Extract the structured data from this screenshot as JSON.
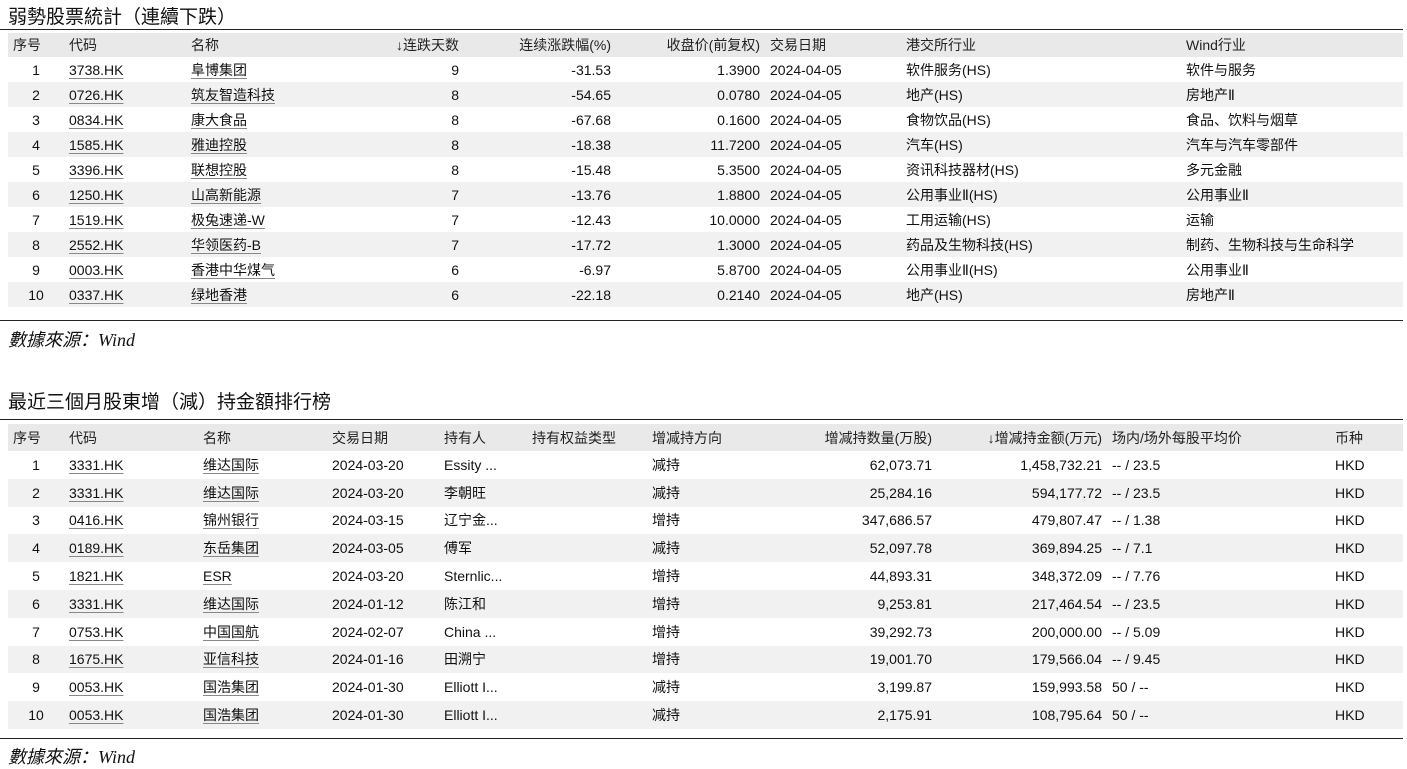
{
  "section1": {
    "title": "弱勢股票統計（連續下跌）",
    "headers": [
      "序号",
      "代码",
      "名称",
      "↓连跌天数",
      "连续涨跌幅(%)",
      "收盘价(前复权)",
      "交易日期",
      "港交所行业",
      "Wind行业"
    ],
    "rows": [
      [
        "1",
        "3738.HK",
        "阜博集团",
        "9",
        "-31.53",
        "1.3900",
        "2024-04-05",
        "软件服务(HS)",
        "软件与服务"
      ],
      [
        "2",
        "0726.HK",
        "筑友智造科技",
        "8",
        "-54.65",
        "0.0780",
        "2024-04-05",
        "地产(HS)",
        "房地产Ⅱ"
      ],
      [
        "3",
        "0834.HK",
        "康大食品",
        "8",
        "-67.68",
        "0.1600",
        "2024-04-05",
        "食物饮品(HS)",
        "食品、饮料与烟草"
      ],
      [
        "4",
        "1585.HK",
        "雅迪控股",
        "8",
        "-18.38",
        "11.7200",
        "2024-04-05",
        "汽车(HS)",
        "汽车与汽车零部件"
      ],
      [
        "5",
        "3396.HK",
        "联想控股",
        "8",
        "-15.48",
        "5.3500",
        "2024-04-05",
        "资讯科技器材(HS)",
        "多元金融"
      ],
      [
        "6",
        "1250.HK",
        "山高新能源",
        "7",
        "-13.76",
        "1.8800",
        "2024-04-05",
        "公用事业Ⅱ(HS)",
        "公用事业Ⅱ"
      ],
      [
        "7",
        "1519.HK",
        "极兔速递-W",
        "7",
        "-12.43",
        "10.0000",
        "2024-04-05",
        "工用运输(HS)",
        "运输"
      ],
      [
        "8",
        "2552.HK",
        "华领医药-B",
        "7",
        "-17.72",
        "1.3000",
        "2024-04-05",
        "药品及生物科技(HS)",
        "制药、生物科技与生命科学"
      ],
      [
        "9",
        "0003.HK",
        "香港中华煤气",
        "6",
        "-6.97",
        "5.8700",
        "2024-04-05",
        "公用事业Ⅱ(HS)",
        "公用事业Ⅱ"
      ],
      [
        "10",
        "0337.HK",
        "绿地香港",
        "6",
        "-22.18",
        "0.2140",
        "2024-04-05",
        "地产(HS)",
        "房地产Ⅱ"
      ]
    ],
    "source": "數據來源：Wind"
  },
  "section2": {
    "title": "最近三個月股東增（減）持金額排行榜",
    "headers": [
      "序号",
      "代码",
      "名称",
      "交易日期",
      "持有人",
      "持有权益类型",
      "增减持方向",
      "增减持数量(万股)",
      "↓增减持金额(万元)",
      "场内/场外每股平均价",
      "币种"
    ],
    "rows": [
      [
        "1",
        "3331.HK",
        "维达国际",
        "2024-03-20",
        "Essity ...",
        "",
        "减持",
        "62,073.71",
        "1,458,732.21",
        "-- / 23.5",
        "HKD"
      ],
      [
        "2",
        "3331.HK",
        "维达国际",
        "2024-03-20",
        "李朝旺",
        "",
        "减持",
        "25,284.16",
        "594,177.72",
        "-- / 23.5",
        "HKD"
      ],
      [
        "3",
        "0416.HK",
        "锦州银行",
        "2024-03-15",
        "辽宁金...",
        "",
        "增持",
        "347,686.57",
        "479,807.47",
        "-- / 1.38",
        "HKD"
      ],
      [
        "4",
        "0189.HK",
        "东岳集团",
        "2024-03-05",
        "傅军",
        "",
        "减持",
        "52,097.78",
        "369,894.25",
        "-- / 7.1",
        "HKD"
      ],
      [
        "5",
        "1821.HK",
        "ESR",
        "2024-03-20",
        "Sternlic...",
        "",
        "增持",
        "44,893.31",
        "348,372.09",
        "-- / 7.76",
        "HKD"
      ],
      [
        "6",
        "3331.HK",
        "维达国际",
        "2024-01-12",
        "陈江和",
        "",
        "增持",
        "9,253.81",
        "217,464.54",
        "-- / 23.5",
        "HKD"
      ],
      [
        "7",
        "0753.HK",
        "中国国航",
        "2024-02-07",
        "China ...",
        "",
        "增持",
        "39,292.73",
        "200,000.00",
        "-- / 5.09",
        "HKD"
      ],
      [
        "8",
        "1675.HK",
        "亚信科技",
        "2024-01-16",
        "田溯宁",
        "",
        "增持",
        "19,001.70",
        "179,566.04",
        "-- / 9.45",
        "HKD"
      ],
      [
        "9",
        "0053.HK",
        "国浩集团",
        "2024-01-30",
        "Elliott I...",
        "",
        "减持",
        "3,199.87",
        "159,993.58",
        "50 / --",
        "HKD"
      ],
      [
        "10",
        "0053.HK",
        "国浩集团",
        "2024-01-30",
        "Elliott I...",
        "",
        "减持",
        "2,175.91",
        "108,795.64",
        "50 / --",
        "HKD"
      ]
    ],
    "source": "數據來源：Wind"
  }
}
